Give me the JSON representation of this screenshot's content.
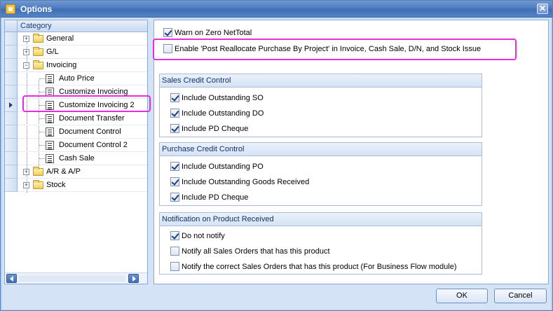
{
  "window": {
    "title": "Options",
    "close_glyph": "✕"
  },
  "tree": {
    "header": "Category",
    "items": [
      {
        "label": "General",
        "type": "folder",
        "expander": "+"
      },
      {
        "label": "G/L",
        "type": "folder",
        "expander": "+"
      },
      {
        "label": "Invoicing",
        "type": "folder",
        "expander": "−"
      },
      {
        "label": "Auto Price",
        "type": "doc"
      },
      {
        "label": "Customize Invoicing",
        "type": "doc"
      },
      {
        "label": "Customize Invoicing 2",
        "type": "doc",
        "selected": true
      },
      {
        "label": "Document Transfer",
        "type": "doc"
      },
      {
        "label": "Document Control",
        "type": "doc"
      },
      {
        "label": "Document Control 2",
        "type": "doc"
      },
      {
        "label": "Cash Sale",
        "type": "doc"
      },
      {
        "label": "A/R & A/P",
        "type": "folder",
        "expander": "+"
      },
      {
        "label": "Stock",
        "type": "folder",
        "expander": "+"
      }
    ]
  },
  "options": {
    "warn_zero_nettotal": {
      "label": "Warn on Zero NetTotal",
      "checked": true
    },
    "enable_post_reallocate": {
      "label": "Enable 'Post Reallocate Purchase By Project' in Invoice, Cash Sale, D/N, and Stock Issue",
      "checked": false
    }
  },
  "sales_credit_control": {
    "title": "Sales Credit Control",
    "items": [
      {
        "label": "Include Outstanding SO",
        "checked": true
      },
      {
        "label": "Include Outstanding DO",
        "checked": true
      },
      {
        "label": "Include PD Cheque",
        "checked": true
      }
    ]
  },
  "purchase_credit_control": {
    "title": "Purchase Credit Control",
    "items": [
      {
        "label": "Include Outstanding PO",
        "checked": true
      },
      {
        "label": "Include Outstanding Goods Received",
        "checked": true
      },
      {
        "label": "Include PD Cheque",
        "checked": true
      }
    ]
  },
  "notification": {
    "title": "Notification on Product Received",
    "items": [
      {
        "label": "Do not notify",
        "checked": true
      },
      {
        "label": "Notify all Sales Orders that has this product",
        "checked": false
      },
      {
        "label": "Notify the correct Sales Orders that has this product (For Business Flow module)",
        "checked": false
      }
    ]
  },
  "buttons": {
    "ok": "OK",
    "cancel": "Cancel"
  },
  "colors": {
    "highlight": "#e62ee0",
    "title_bar": "#4c79bf",
    "client_bg": "#d4e3f5"
  }
}
